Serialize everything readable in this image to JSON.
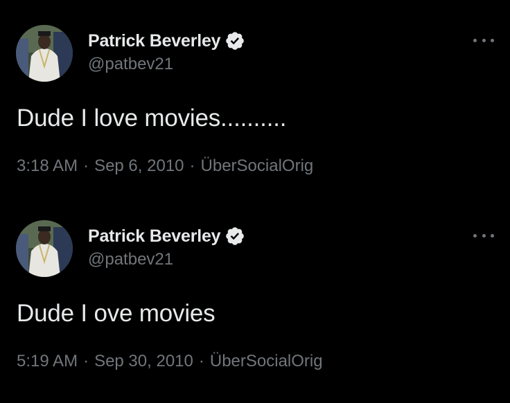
{
  "colors": {
    "background": "#000000",
    "primary_text": "#e7e9ea",
    "secondary_text": "#71767b",
    "verified_badge": "#e7e9ea"
  },
  "tweets": [
    {
      "author": {
        "display_name": "Patrick Beverley",
        "handle": "@patbev21",
        "verified_icon": "verified-badge-icon",
        "avatar_icon": "profile-photo"
      },
      "text": "Dude I love movies..........",
      "time": "3:18 AM",
      "date": "Sep 6, 2010",
      "source": "ÜberSocialOrig",
      "separator": "·",
      "more_icon": "more-options-icon"
    },
    {
      "author": {
        "display_name": "Patrick Beverley",
        "handle": "@patbev21",
        "verified_icon": "verified-badge-icon",
        "avatar_icon": "profile-photo"
      },
      "text": "Dude I ove movies",
      "time": "5:19 AM",
      "date": "Sep 30, 2010",
      "source": "ÜberSocialOrig",
      "separator": "·",
      "more_icon": "more-options-icon"
    }
  ]
}
